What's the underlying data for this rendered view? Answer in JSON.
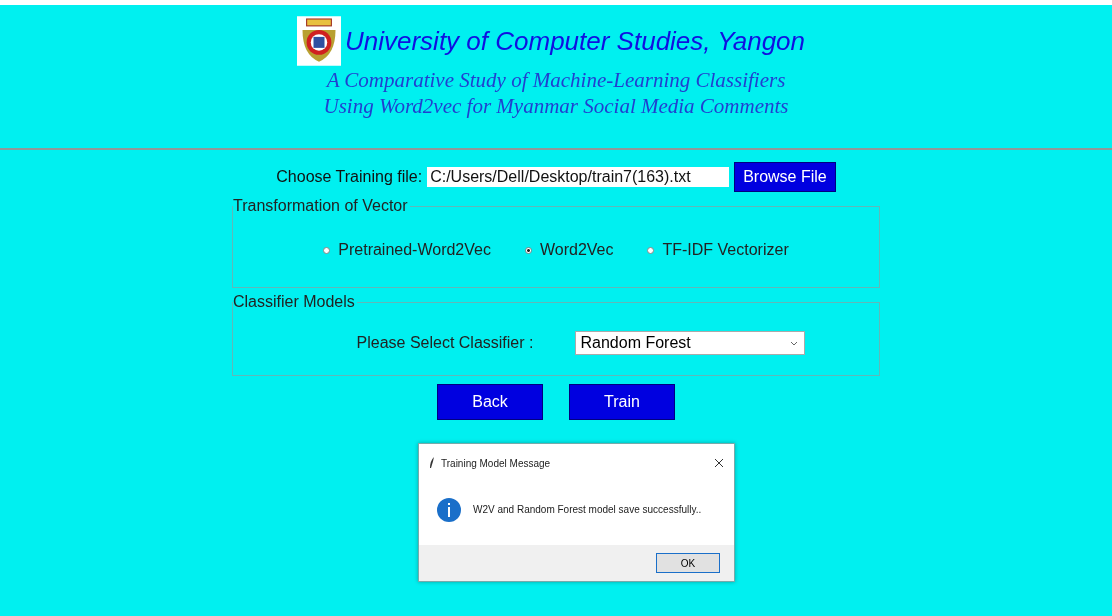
{
  "header": {
    "title": "University of Computer Studies, Yangon",
    "subtitle_lines": [
      "A Comparative Study of Machine-Learning Classifiers",
      "Using Word2vec for Myanmar Social Media Comments"
    ]
  },
  "file_row": {
    "label": "Choose Training file:",
    "value": "C:/Users/Dell/Desktop/train7(163).txt",
    "button": "Browse File"
  },
  "vector_group": {
    "title": "Transformation of Vector",
    "options": [
      {
        "label": "Pretrained-Word2Vec",
        "selected": false
      },
      {
        "label": "Word2Vec",
        "selected": true
      },
      {
        "label": "TF-IDF Vectorizer",
        "selected": false
      }
    ]
  },
  "classifier_group": {
    "title": "Classifier Models",
    "label": "Please Select Classifier :",
    "value": "Random Forest"
  },
  "buttons": [
    "Back",
    "Train"
  ],
  "dialog": {
    "title": "Training Model Message",
    "message": "W2V and Random Forest model save successfully..",
    "button": "OK"
  }
}
